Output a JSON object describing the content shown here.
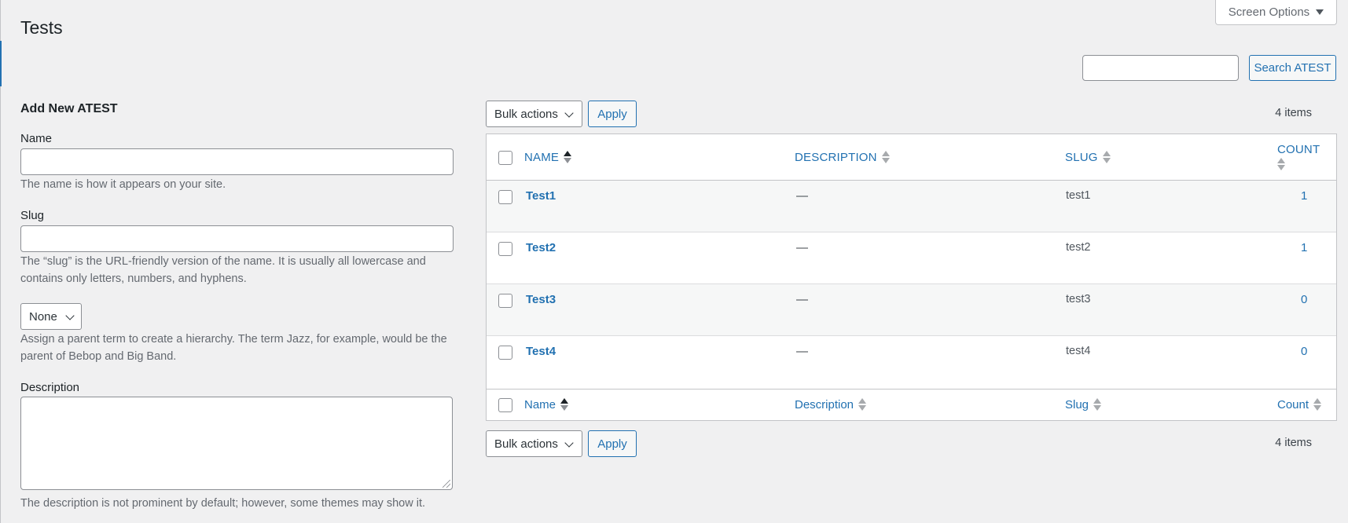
{
  "page": {
    "title": "Tests",
    "screen_options_label": "Screen Options"
  },
  "search": {
    "value": "",
    "button_label": "Search ATEST"
  },
  "form": {
    "title": "Add New ATEST",
    "name_label": "Name",
    "name_value": "",
    "name_help": "The name is how it appears on your site.",
    "slug_label": "Slug",
    "slug_value": "",
    "slug_help": "The “slug” is the URL-friendly version of the name. It is usually all lowercase and contains only letters, numbers, and hyphens.",
    "parent_selected": "None",
    "parent_help": "Assign a parent term to create a hierarchy. The term Jazz, for example, would be the parent of Bebop and Big Band.",
    "description_label": "Description",
    "description_value": "",
    "description_help": "The description is not prominent by default; however, some themes may show it."
  },
  "table": {
    "bulk_actions_label": "Bulk actions",
    "apply_label": "Apply",
    "items_count": "4 items",
    "header": {
      "name": "NAME",
      "description": "DESCRIPTION",
      "slug": "SLUG",
      "count": "COUNT"
    },
    "footer": {
      "name": "Name",
      "description": "Description",
      "slug": "Slug",
      "count": "Count"
    },
    "rows": [
      {
        "name": "Test1",
        "description": "—",
        "slug": "test1",
        "count": "1"
      },
      {
        "name": "Test2",
        "description": "—",
        "slug": "test2",
        "count": "1"
      },
      {
        "name": "Test3",
        "description": "—",
        "slug": "test3",
        "count": "0"
      },
      {
        "name": "Test4",
        "description": "—",
        "slug": "test4",
        "count": "0"
      }
    ]
  },
  "colors": {
    "link": "#2271b1",
    "background": "#f0f0f1",
    "border": "#c3c4c7",
    "text": "#3c434a"
  }
}
